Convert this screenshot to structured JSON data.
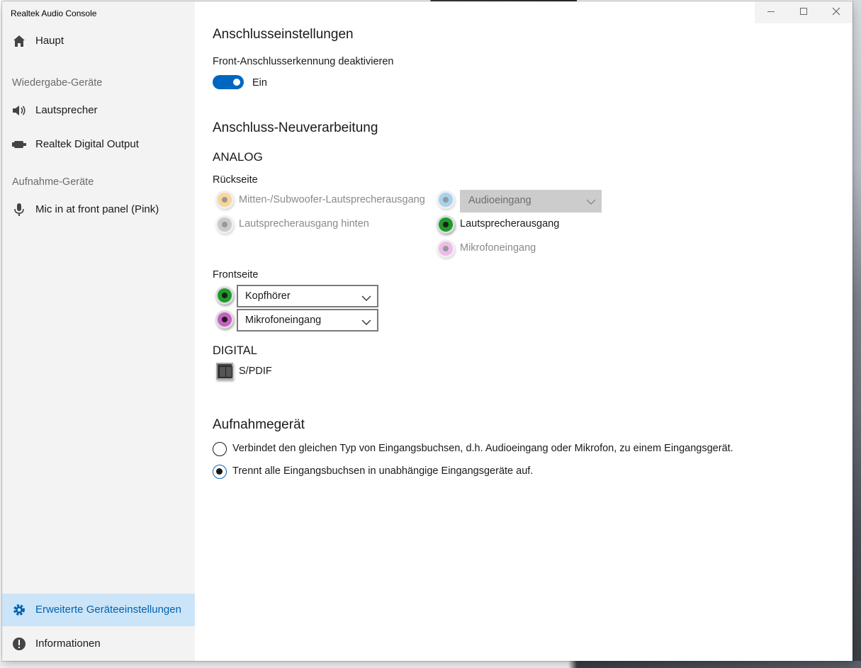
{
  "window": {
    "title": "Realtek Audio Console",
    "controls": {
      "minimize": "minimize-icon",
      "maximize": "maximize-icon",
      "close": "close-icon"
    }
  },
  "sidebar": {
    "home": "Haupt",
    "playback_header": "Wiedergabe-Geräte",
    "playback_items": [
      "Lautsprecher",
      "Realtek Digital Output"
    ],
    "recording_header": "Aufnahme-Geräte",
    "recording_items": [
      "Mic in at front panel (Pink)"
    ],
    "advanced": "Erweiterte Geräteeinstellungen",
    "info": "Informationen"
  },
  "connector_settings": {
    "title": "Anschlusseinstellungen",
    "front_detect_label": "Front-Anschlusserkennung deaktivieren",
    "toggle_state": "Ein",
    "toggle_on": true
  },
  "retasking": {
    "title": "Anschluss-Neuverarbeitung",
    "analog_label": "ANALOG",
    "rear_label": "Rückseite",
    "rear_jacks": [
      {
        "label": "Mitten-/Subwoofer-Lautsprecherausgang",
        "color": "#f5a623",
        "enabled": false
      },
      {
        "label": "Lautsprecherausgang hinten",
        "color": "#8c8c8c",
        "enabled": false
      }
    ],
    "rear_blue_dropdown": "Audioeingang",
    "rear_blue_color": "#3a9ee0",
    "rear_right_jacks": [
      {
        "label": "Lautsprecherausgang",
        "color": "#1f9a2a",
        "enabled": true
      },
      {
        "label": "Mikrofoneingang",
        "color": "#d86fd0",
        "enabled": false
      }
    ],
    "front_label": "Frontseite",
    "front_jacks": [
      {
        "color": "#1f9a2a",
        "value": "Kopfhörer"
      },
      {
        "color": "#c75fc4",
        "value": "Mikrofoneingang"
      }
    ],
    "digital_label": "DIGITAL",
    "spdif_label": "S/PDIF"
  },
  "recording_device": {
    "title": "Aufnahmegerät",
    "options": [
      "Verbindet den gleichen Typ von Eingangsbuchsen, d.h. Audioeingang oder Mikrofon, zu einem Eingangsgerät.",
      "Trennt alle Eingangsbuchsen in unabhängige Eingangsgeräte auf."
    ],
    "selected_index": 1
  },
  "colors": {
    "accent": "#0067c0",
    "active_nav_bg": "#cce4f7",
    "sidebar_bg": "#f3f3f3"
  }
}
